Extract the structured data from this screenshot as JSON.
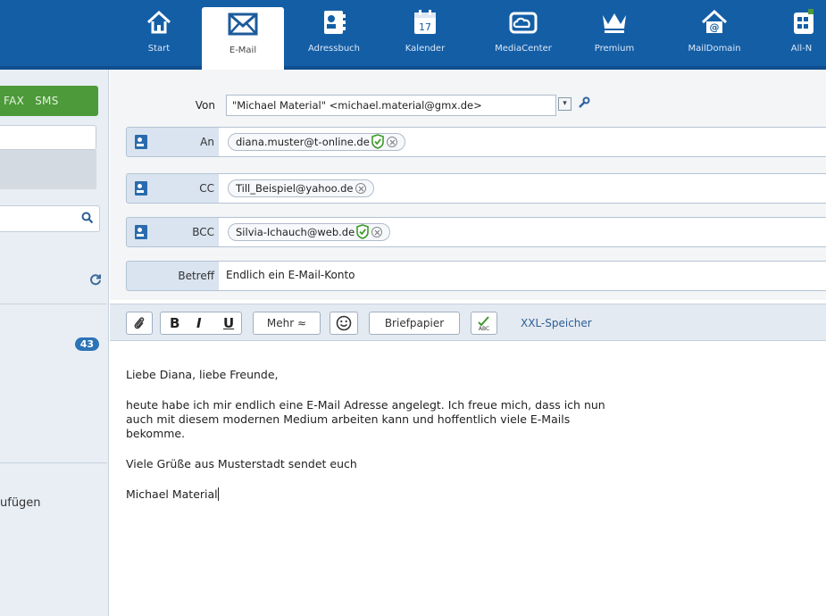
{
  "nav": {
    "items": [
      {
        "label": "Start",
        "icon": "house-icon"
      },
      {
        "label": "E-Mail",
        "icon": "envelope-icon",
        "active": true
      },
      {
        "label": "Adressbuch",
        "icon": "address-card-icon"
      },
      {
        "label": "Kalender",
        "icon": "calendar-icon",
        "day": "17"
      },
      {
        "label": "MediaCenter",
        "icon": "cloud-folder-icon"
      },
      {
        "label": "Premium",
        "icon": "crown-icon"
      },
      {
        "label": "MailDomain",
        "icon": "at-house-icon"
      },
      {
        "label": "All-N",
        "icon": "apps-icon"
      }
    ]
  },
  "sidebar": {
    "tabs": [
      "FAX",
      "SMS"
    ],
    "badge": "43",
    "add_label": "ufügen"
  },
  "compose": {
    "from_label": "Von",
    "from_value": "\"Michael Material\" <michael.material@gmx.de>",
    "to_label": "An",
    "to_value": "diana.muster@t-online.de",
    "cc_label": "CC",
    "cc_value": "Till_Beispiel@yahoo.de",
    "bcc_label": "BCC",
    "bcc_value": "Silvia-Ichauch@web.de",
    "subject_label": "Betreff",
    "subject_value": "Endlich ein E-Mail-Konto"
  },
  "toolbar": {
    "bold": "B",
    "italic": "I",
    "underline": "U",
    "more": "Mehr ≈",
    "stationery": "Briefpapier",
    "xxl": "XXL-Speicher"
  },
  "body": {
    "greeting": "Liebe Diana, liebe Freunde,",
    "paragraph_1": "heute habe ich mir endlich eine E-Mail Adresse angelegt. Ich freue mich, dass ich nun",
    "paragraph_2": "auch mit diesem modernen Medium arbeiten kann und hoffentlich viele E-Mails",
    "paragraph_3": "bekomme.",
    "closing": "Viele Grüße aus Musterstadt sendet euch",
    "signature": "Michael Material"
  },
  "colors": {
    "nav_bg": "#145ea6",
    "sms_green": "#4c9a3a",
    "badge_blue": "#2d73b8",
    "row_bg": "#d9e4f0",
    "verified_green": "#3e9a2c"
  }
}
